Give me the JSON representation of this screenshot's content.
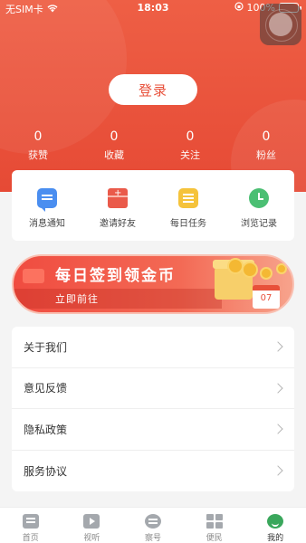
{
  "status_bar": {
    "carrier": "无SIM卡",
    "time": "18:03",
    "battery": "100%"
  },
  "header": {
    "login_label": "登录",
    "stats": [
      {
        "value": "0",
        "label": "获赞"
      },
      {
        "value": "0",
        "label": "收藏"
      },
      {
        "value": "0",
        "label": "关注"
      },
      {
        "value": "0",
        "label": "粉丝"
      }
    ]
  },
  "quick_actions": [
    {
      "label": "消息通知",
      "icon": "message-icon"
    },
    {
      "label": "邀请好友",
      "icon": "invite-envelope-icon"
    },
    {
      "label": "每日任务",
      "icon": "task-list-icon"
    },
    {
      "label": "浏览记录",
      "icon": "clock-icon"
    }
  ],
  "banner": {
    "title": "每日签到领金币",
    "subtitle": "立即前往",
    "calendar_day": "07"
  },
  "menu": [
    {
      "label": "关于我们"
    },
    {
      "label": "意见反馈"
    },
    {
      "label": "隐私政策"
    },
    {
      "label": "服务协议"
    }
  ],
  "tabbar": [
    {
      "label": "首页",
      "icon": "home-icon",
      "active": false
    },
    {
      "label": "视听",
      "icon": "video-icon",
      "active": false
    },
    {
      "label": "察号",
      "icon": "chat-icon",
      "active": false
    },
    {
      "label": "便民",
      "icon": "grid-icon",
      "active": false
    },
    {
      "label": "我的",
      "icon": "profile-icon",
      "active": true
    }
  ],
  "colors": {
    "brand": "#e8503a",
    "active_tab": "#3aa75c"
  }
}
